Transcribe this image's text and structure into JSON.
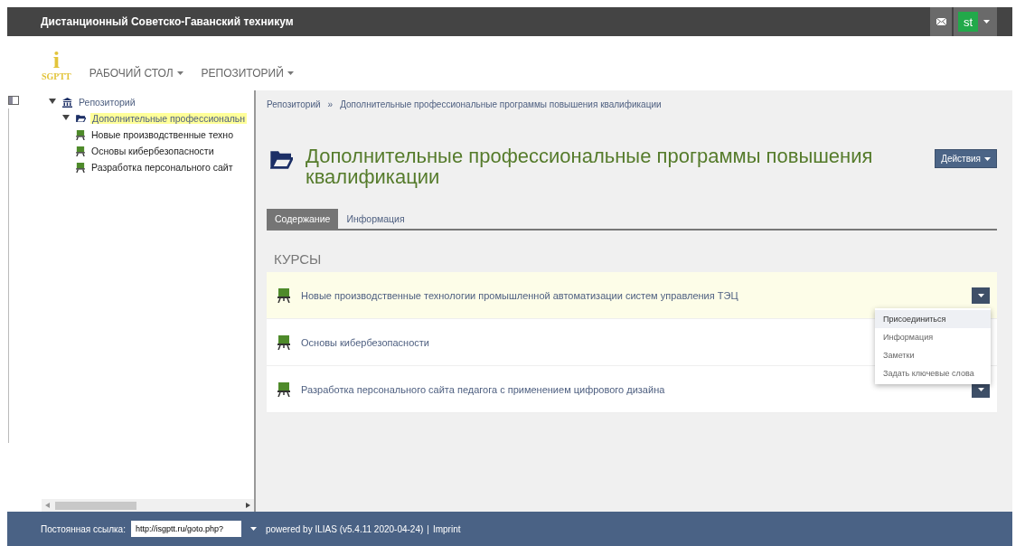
{
  "top_bar": {
    "title": "Дистанционный Советско-Гаванский техникум",
    "user_initials": "st"
  },
  "header": {
    "logo_letter": "i",
    "logo_text": "SGPTT",
    "nav": [
      {
        "label": "РАБОЧИЙ СТОЛ"
      },
      {
        "label": "РЕПОЗИТОРИЙ"
      }
    ]
  },
  "tree": [
    {
      "label": "Репозиторий",
      "kind": "root",
      "expanded": true,
      "selected": false,
      "children": [
        {
          "label": "Дополнительные профессиональн",
          "kind": "folder",
          "expanded": true,
          "selected": true,
          "children": [
            {
              "label": "Новые производственные техно",
              "kind": "course",
              "selected": false
            },
            {
              "label": "Основы кибербезопасности",
              "kind": "course",
              "selected": false
            },
            {
              "label": "Разработка персонального сайт",
              "kind": "course",
              "selected": false
            }
          ]
        }
      ]
    }
  ],
  "breadcrumb": [
    "Репозиторий",
    "Дополнительные профессиональные программы повышения квалификации"
  ],
  "breadcrumb_separator": "»",
  "page_title": "Дополнительные профессиональные программы повышения квалификации",
  "actions_button": "Действия",
  "tabs": [
    {
      "label": "Содержание",
      "selected": true
    },
    {
      "label": "Информация",
      "selected": false
    }
  ],
  "section_title": "КУРСЫ",
  "courses": [
    {
      "title": "Новые производственные технологии промышленной автоматизации систем управления ТЭЦ",
      "selected": true,
      "actions_button": true
    },
    {
      "title": "Основы кибербезопасности",
      "selected": false
    },
    {
      "title": "Разработка персонального сайта педагога с применением цифрового дизайна",
      "selected": false,
      "actions_button": true
    }
  ],
  "dropdown_menu": [
    {
      "label": "Присоединиться",
      "selected": true
    },
    {
      "label": "Информация",
      "selected": false
    },
    {
      "label": "Заметки",
      "selected": false
    },
    {
      "label": "Задать ключевые слова",
      "selected": false
    }
  ],
  "footer": {
    "permalink_label": "Постоянная ссылка:",
    "permalink_value": "http://isgptt.ru/goto.php?",
    "powered_by": "powered by ILIAS (v5.4.11 2020-04-24)",
    "separator": "|",
    "imprint": "Imprint"
  }
}
